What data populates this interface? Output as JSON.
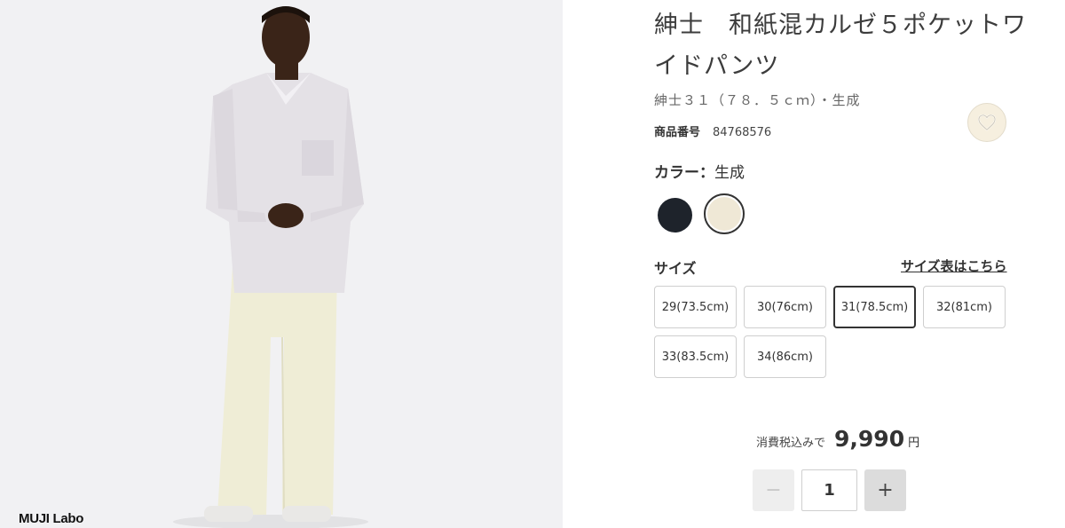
{
  "photo": {
    "brand_label": "MUJI Labo"
  },
  "product": {
    "title": "紳士　和紙混カルゼ５ポケットワイドパンツ",
    "subtitle": "紳士３１（７８．５ｃｍ）・生成",
    "number_label": "商品番号",
    "number_value": "84768576"
  },
  "favorite": {
    "icon": "heart-outline-icon"
  },
  "color": {
    "label": "カラー：",
    "selected": "生成",
    "swatches": [
      {
        "name": "navy",
        "hex": "#1e232b"
      },
      {
        "name": "生成",
        "hex": "#efe8d6",
        "selected": true
      }
    ]
  },
  "size": {
    "label": "サイズ",
    "chart_link": "サイズ表はこちら",
    "options": [
      {
        "label": "29(73.5cm)"
      },
      {
        "label": "30(76cm)"
      },
      {
        "label": "31(78.5cm)",
        "selected": true
      },
      {
        "label": "32(81cm)"
      },
      {
        "label": "33(83.5cm)"
      },
      {
        "label": "34(86cm)"
      }
    ]
  },
  "price": {
    "tax_label": "消費税込みで",
    "amount": "9,990",
    "currency": "円"
  },
  "quantity": {
    "value": "1",
    "minus_symbol": "−",
    "plus_symbol": "+"
  }
}
